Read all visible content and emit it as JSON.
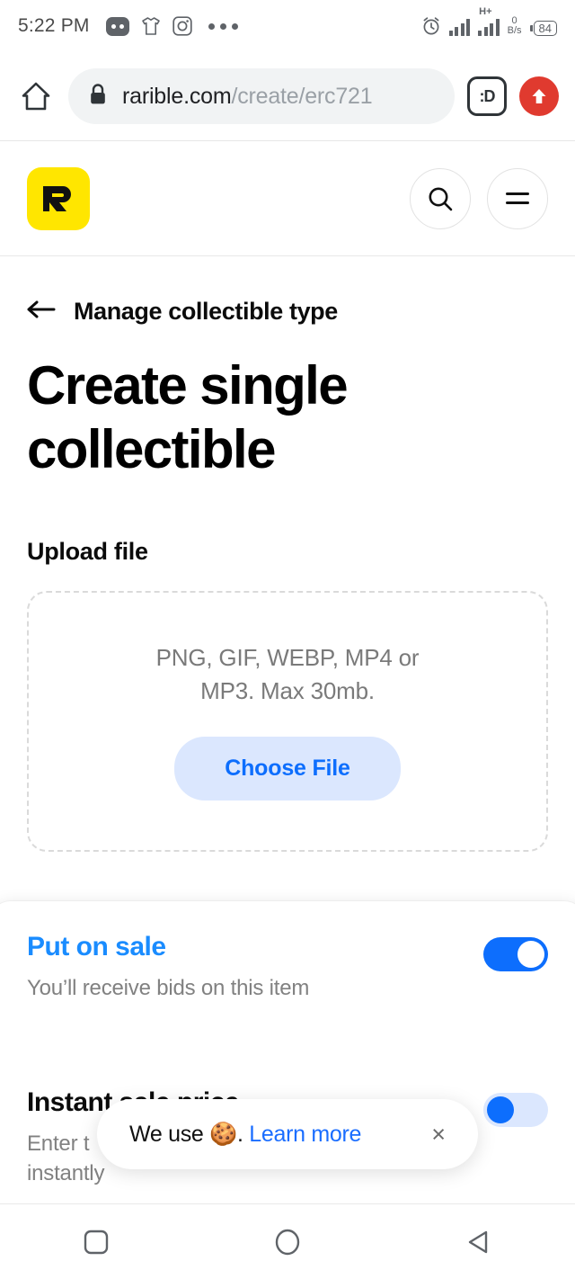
{
  "statusbar": {
    "time": "5:22 PM",
    "left_icons": [
      "game-controller-icon",
      "tshirt-icon",
      "instagram-icon",
      "more-dots-icon"
    ],
    "right_icons": [
      "alarm-icon",
      "signal-bars-icon",
      "signal-hplus-icon"
    ],
    "network_type": "H+",
    "data_rate_value": "0",
    "data_rate_unit": "B/s",
    "battery_level": "84"
  },
  "browser": {
    "home_icon": "home-icon",
    "lock_icon": "lock-icon",
    "url_domain": "rarible.com",
    "url_path": "/create/erc721",
    "face_button_label": ":D",
    "upload_button_icon": "upload-arrow-icon"
  },
  "site_header": {
    "logo_letter": "R",
    "logo_color": "#FFE600",
    "search_icon": "search-icon",
    "menu_icon": "hamburger-menu-icon"
  },
  "page": {
    "back_label": "Manage collectible type",
    "back_icon": "arrow-left-icon",
    "title": "Create single collectible",
    "upload_section_label": "Upload file",
    "dropzone_text": "PNG, GIF, WEBP, MP4 or MP3. Max 30mb.",
    "choose_file_label": "Choose File"
  },
  "sale_card": {
    "put_on_sale": {
      "title": "Put on sale",
      "subtitle": "You’ll receive bids on this item",
      "toggle_state": "on"
    },
    "instant_sale_price": {
      "title": "Instant sale price",
      "subtitle_line1": "Enter t",
      "subtitle_line2": "instantly",
      "toggle_state": "off"
    }
  },
  "cookie_banner": {
    "text_before": "We use ",
    "emoji": "🍪",
    "text_after": ". ",
    "link_label": "Learn more",
    "close_label": "×"
  },
  "navbar": {
    "recents_icon": "square-recents-icon",
    "home_icon": "circle-home-icon",
    "back_icon": "triangle-back-icon"
  },
  "colors": {
    "accent_blue": "#0d6efd",
    "link_blue": "#1a8cff",
    "brand_yellow": "#FFE600",
    "red": "#e03a2f"
  }
}
